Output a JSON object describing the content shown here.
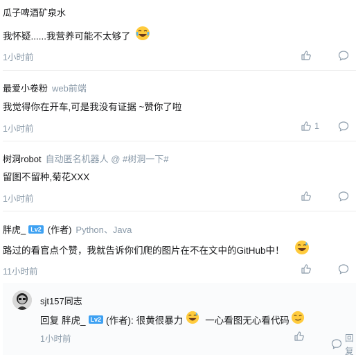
{
  "comments": [
    {
      "author": "瓜子啤酒矿泉水",
      "content": "我怀疑......我营养可能不太够了",
      "emoji": "crying-laughing",
      "time": "1小时前",
      "likes": ""
    },
    {
      "author": "最爱小卷粉",
      "subtitle": "web前端",
      "content": "我觉得你在开车,可是我没有证据   ~赞你了啦",
      "time": "1小时前",
      "likes": "1"
    },
    {
      "author": "树洞robot",
      "subtitle": "自动匿名机器人 @ #树洞一下#",
      "content": "留图不留种,菊花XXX",
      "time": "1小时前",
      "likes": ""
    },
    {
      "author": "胖虎_",
      "badge": "Lv2",
      "role": "(作者)",
      "subtitle": "Python、Java",
      "content": "路过的看官点个赞，我就告诉你们爬的图片在不在文中的GitHub中！",
      "emoji": "grinning-sweat",
      "time": "11小时前",
      "likes": ""
    }
  ],
  "reply": {
    "author": "sjt157同志",
    "prefix": "回复",
    "target": "胖虎_",
    "badge": "Lv2",
    "role": "(作者):",
    "text1": "很黄很暴力",
    "text2": "一心看图无心看代码",
    "time": "1小时前",
    "reply_label": "回复"
  },
  "colors": {
    "text": "#17181a",
    "muted": "#8a9aa9",
    "link": "#406599",
    "badge": "#3ea1f2"
  }
}
